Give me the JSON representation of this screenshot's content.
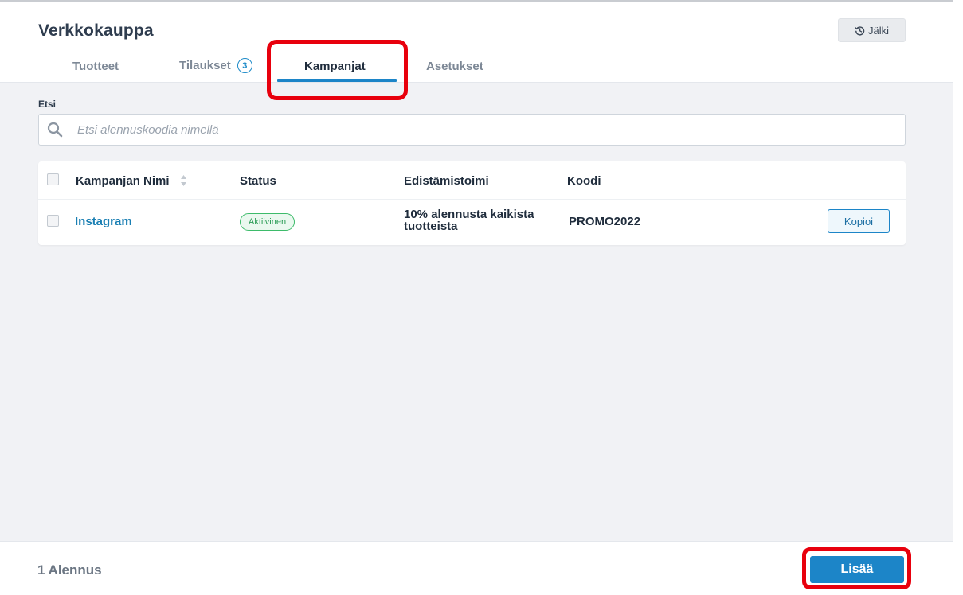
{
  "app": {
    "title": "Verkkokauppa",
    "history_label": "Jälki"
  },
  "tabs": {
    "products": "Tuotteet",
    "orders": "Tilaukset",
    "orders_badge": "3",
    "campaigns": "Kampanjat",
    "settings": "Asetukset",
    "active": "Kampanjat"
  },
  "search": {
    "label": "Etsi",
    "placeholder": "Etsi alennuskoodia nimellä",
    "value": ""
  },
  "table": {
    "headers": {
      "name": "Kampanjan Nimi",
      "status": "Status",
      "promotion": "Edistämistoimi",
      "code": "Koodi"
    },
    "rows": [
      {
        "name": "Instagram",
        "status": "Aktiivinen",
        "promotion": "10% alennusta kaikista tuotteista",
        "code": "PROMO2022",
        "action": "Kopioi"
      }
    ]
  },
  "footer": {
    "count": "1 Alennus",
    "add_label": "Lisää"
  },
  "colors": {
    "accent": "#1c85c8",
    "highlight": "#e8000d",
    "status_active": "#3dbb6a",
    "link": "#1a7fb3"
  },
  "icons": [
    "history-icon",
    "search-icon",
    "sort-icon"
  ]
}
